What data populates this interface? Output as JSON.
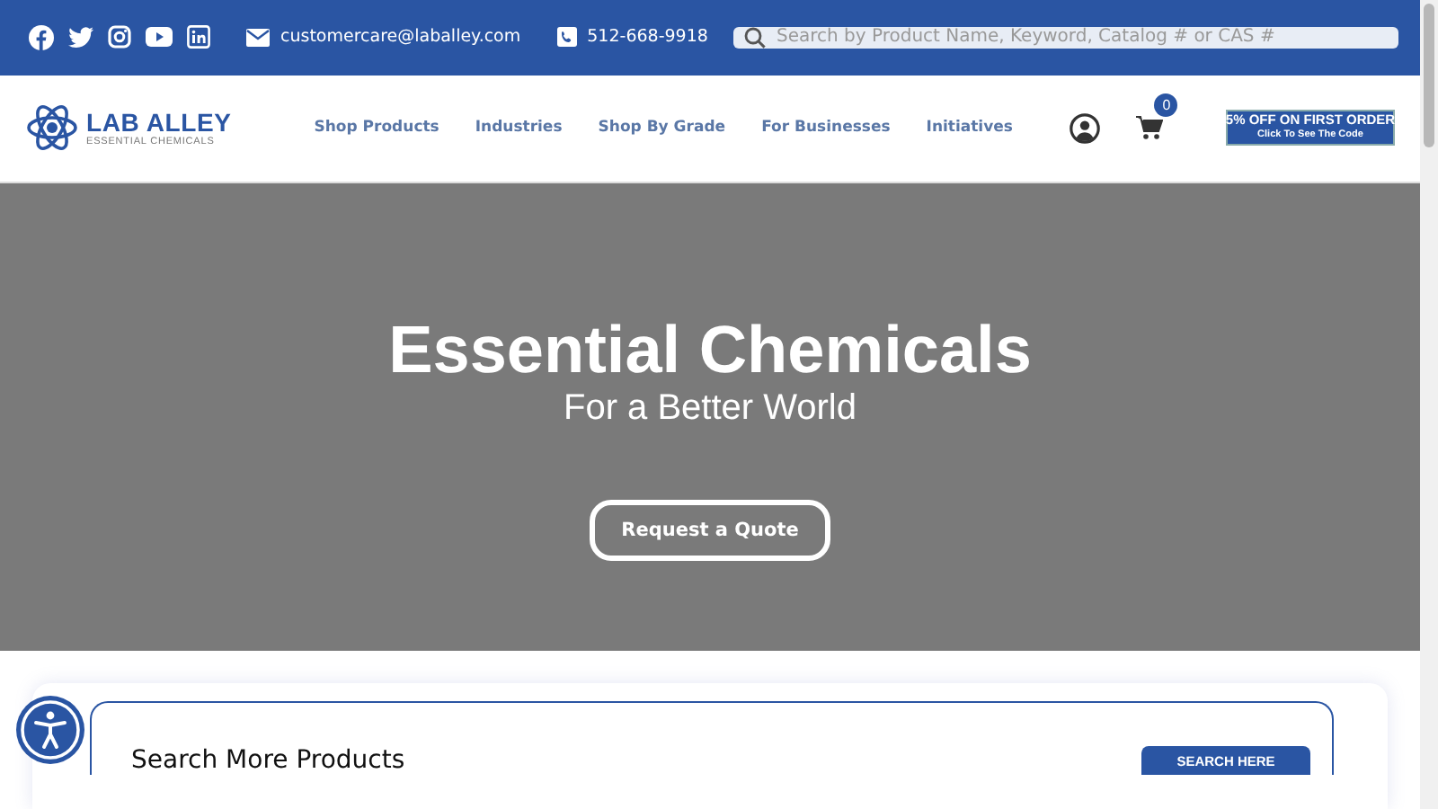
{
  "top_bar": {
    "social": [
      {
        "kind": "facebook"
      },
      {
        "kind": "twitter"
      },
      {
        "kind": "instagram"
      },
      {
        "kind": "youtube"
      },
      {
        "kind": "linkedin"
      }
    ],
    "email": "customercare@laballey.com",
    "phone": "512-668-9918",
    "search": {
      "placeholder": "Search by Product Name, Keyword, Catalog # or CAS #"
    }
  },
  "header": {
    "logo": {
      "name": "LAB ALLEY",
      "tagline": "ESSENTIAL CHEMICALS"
    },
    "nav": [
      {
        "label": "Shop Products"
      },
      {
        "label": "Industries"
      },
      {
        "label": "Shop By Grade"
      },
      {
        "label": "For Businesses"
      },
      {
        "label": "Initiatives"
      }
    ],
    "cart_count": "0",
    "promo": {
      "title": "5% OFF ON FIRST ORDER",
      "subtitle": "Click To See The Code"
    }
  },
  "hero": {
    "title": "Essential Chemicals",
    "subtitle": "For a Better World",
    "button": "Request a Quote"
  },
  "search_section": {
    "title": "Search More Products",
    "button": "SEARCH HERE"
  }
}
